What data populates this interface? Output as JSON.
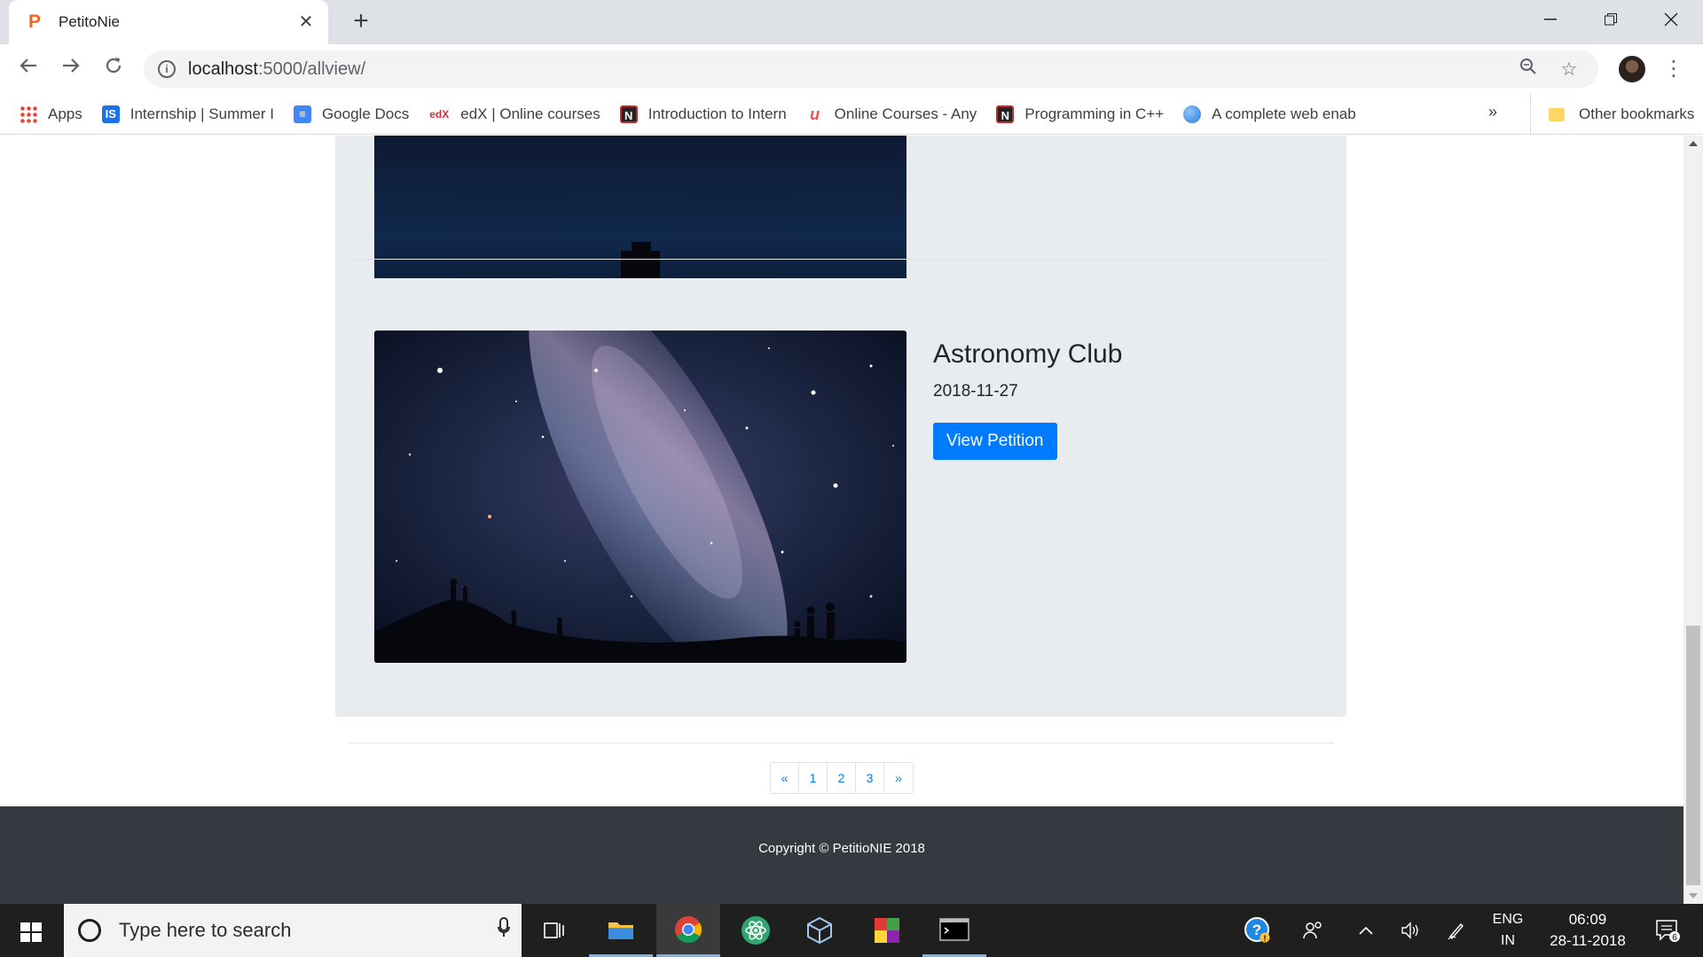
{
  "browser": {
    "tab_title": "PetitoNie",
    "tab_favicon_letter": "P",
    "url_host": "localhost",
    "url_rest": ":5000/allview/",
    "bookmarks": [
      {
        "label": "Apps",
        "icon": "apps-grid-icon"
      },
      {
        "label": "Internship | Summer I",
        "icon": "internshala-icon"
      },
      {
        "label": "Google Docs",
        "icon": "google-docs-icon"
      },
      {
        "label": "edX | Online courses",
        "icon": "edx-icon"
      },
      {
        "label": "Introduction to Intern",
        "icon": "nptel-icon"
      },
      {
        "label": "Online Courses - Any",
        "icon": "udemy-icon"
      },
      {
        "label": "Programming in C++",
        "icon": "nptel-icon"
      },
      {
        "label": "A complete web enab",
        "icon": "globe-icon"
      }
    ],
    "bookmarks_overflow": "»",
    "other_bookmarks": "Other bookmarks"
  },
  "page": {
    "petition": {
      "title": "Astronomy Club",
      "date": "2018-11-27",
      "button": "View Petition"
    },
    "pagination": [
      "«",
      "1",
      "2",
      "3",
      "»"
    ],
    "footer": "Copyright © PetitioNIE 2018"
  },
  "taskbar": {
    "search_placeholder": "Type here to search",
    "lang_top": "ENG",
    "lang_bottom": "IN",
    "time": "06:09",
    "date": "28-11-2018",
    "notification_count": "6"
  },
  "colors": {
    "primary": "#007bff",
    "card_bg": "#e9ecef",
    "footer_bg": "#343a40"
  }
}
